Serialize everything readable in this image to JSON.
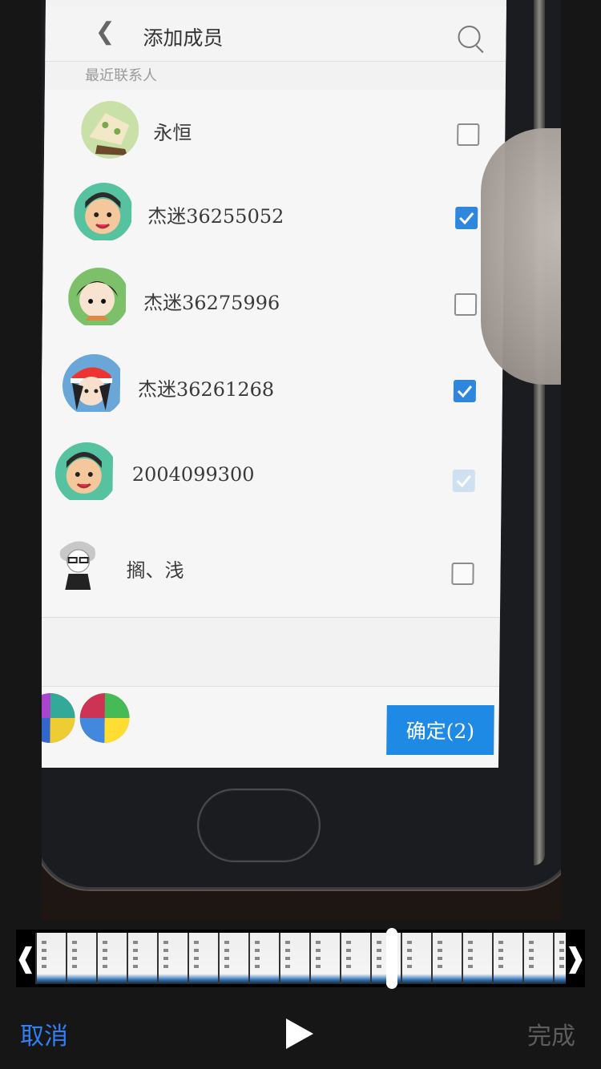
{
  "screen": {
    "title": "添加成员",
    "back_icon": "chevron-left-icon",
    "search_icon": "search-icon",
    "section_label": "最近联系人",
    "contacts": [
      {
        "name": "永恒",
        "checked": false
      },
      {
        "name": "杰迷36255052",
        "checked": true
      },
      {
        "name": "杰迷36275996",
        "checked": false
      },
      {
        "name": "杰迷36261268",
        "checked": true
      },
      {
        "name": "2004099300",
        "checked": true,
        "disabled": true
      },
      {
        "name": "搁、浅",
        "checked": false
      }
    ],
    "confirm_label": "确定(2)",
    "accent_color": "#1e8ae6"
  },
  "toolbar": {
    "cancel_label": "取消",
    "play_icon": "play-icon",
    "done_label": "完成",
    "cancel_color": "#2f7ff6"
  },
  "timeline": {
    "left_handle": "❰",
    "right_handle": "❱",
    "playhead_position": 0.67
  }
}
